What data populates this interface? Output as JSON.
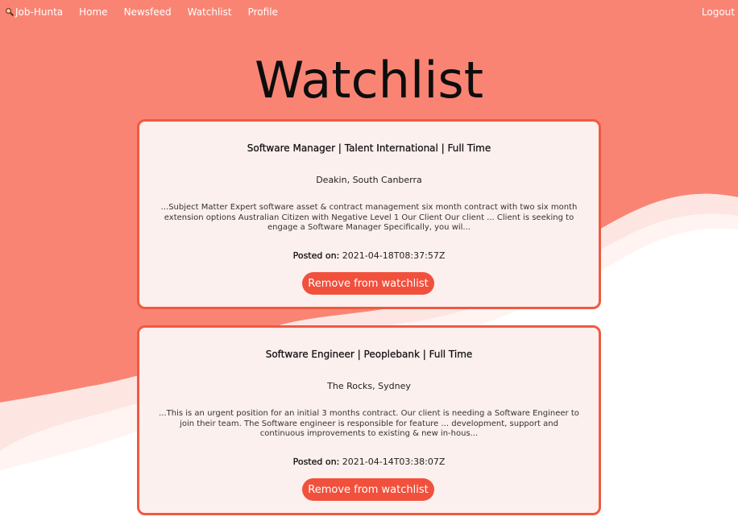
{
  "nav": {
    "brand": "Job-Hunta",
    "links": [
      "Home",
      "Newsfeed",
      "Watchlist",
      "Profile"
    ],
    "logout": "Logout"
  },
  "page": {
    "title": "Watchlist"
  },
  "jobs": [
    {
      "title": "Software Manager | Talent International | Full Time",
      "location": "Deakin, South Canberra",
      "description": "...Subject Matter Expert software asset & contract management six month contract with two six month extension options Australian Citizen with Negative Level 1 Our Client Our client ... Client is seeking to engage a Software Manager Specifically, you wil...",
      "posted_label": "Posted on:",
      "posted_value": "2021-04-18T08:37:57Z",
      "button_label": "Remove from watchlist"
    },
    {
      "title": "Software Engineer | Peoplebank | Full Time",
      "location": "The Rocks, Sydney",
      "description": "...This is an urgent position for an initial 3 months contract. Our client is needing a Software Engineer to join their team. The Software engineer is responsible for feature ... development, support and continuous improvements to existing & new in-hous...",
      "posted_label": "Posted on:",
      "posted_value": "2021-04-14T03:38:07Z",
      "button_label": "Remove from watchlist"
    }
  ],
  "colors": {
    "primary_bg": "#fa8474",
    "wave_light": "#fde6e2",
    "card_bg": "#fcf0ee",
    "card_border": "#ef5a42",
    "button_bg": "#f1503c"
  },
  "icons": {
    "brand": "magnifier-icon"
  }
}
